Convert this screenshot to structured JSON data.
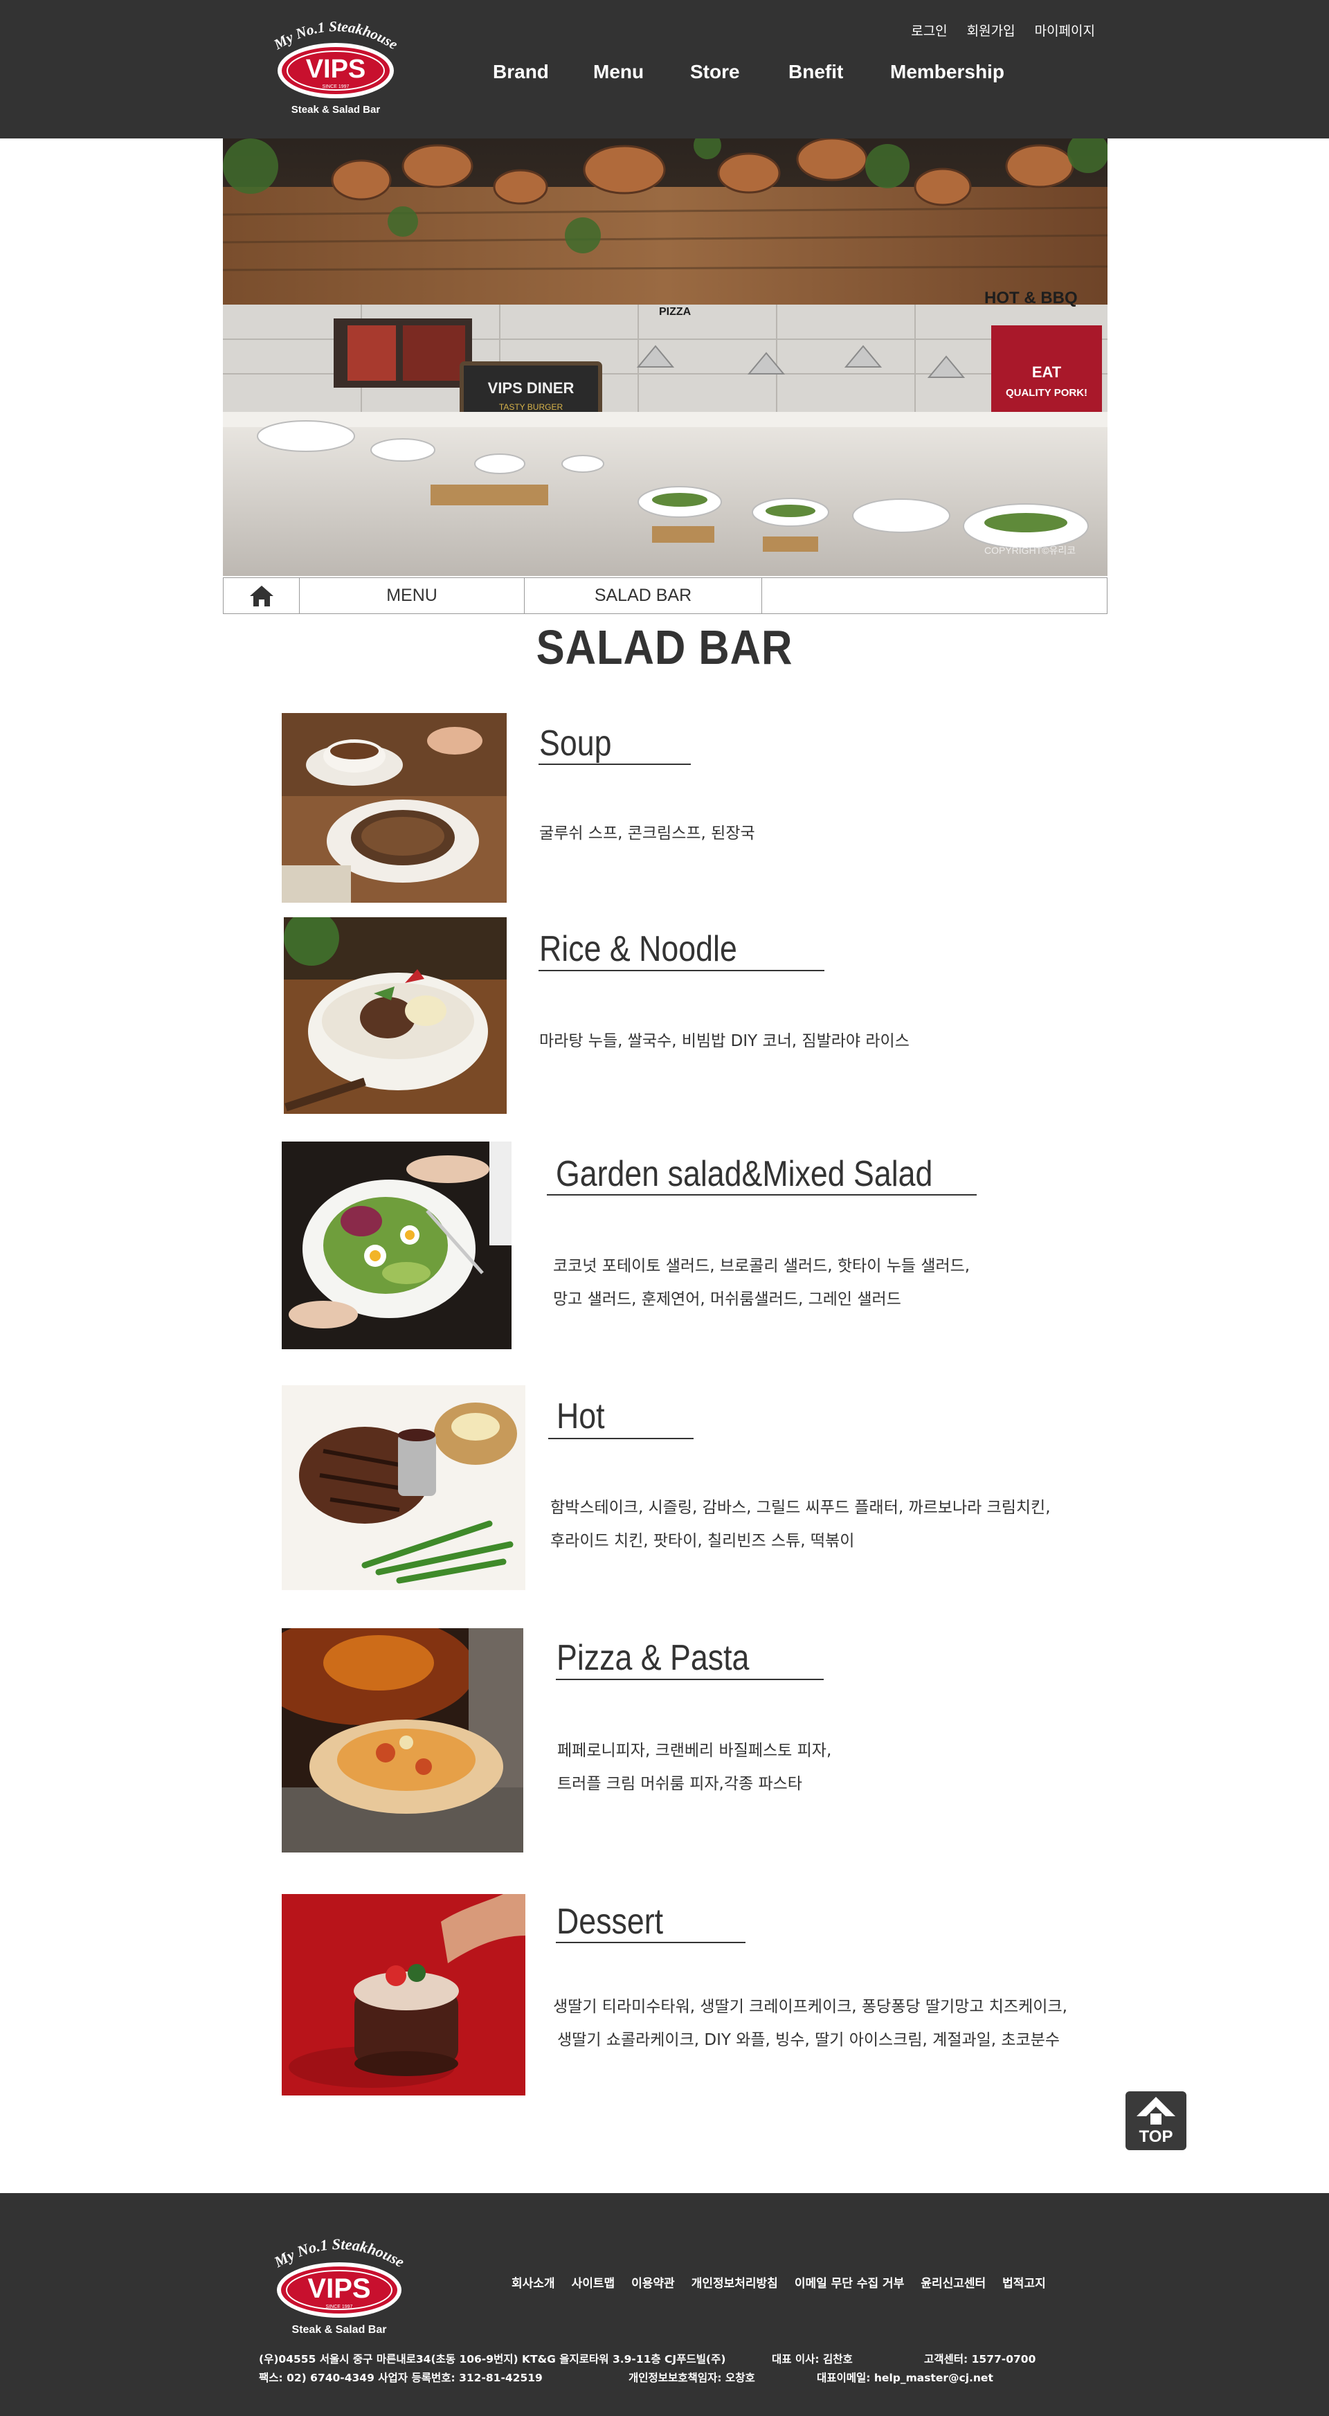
{
  "header": {
    "logo": {
      "tagline": "My No.1 Steakhouse",
      "brand": "VIPS",
      "since": "SINCE 1997",
      "subtitle": "Steak & Salad Bar"
    },
    "util_links": [
      "로그인",
      "회원가입",
      "마이페이지"
    ],
    "nav": [
      "Brand",
      "Menu",
      "Store",
      "Bnefit",
      "Membership"
    ]
  },
  "hero": {
    "signs": [
      "PIZZA",
      "HOT & BBQ",
      "VIPS DINER",
      "TASTY BURGER",
      "EAT",
      "QUALITY PORK!"
    ],
    "watermark": "COPYRIGHT©유리코"
  },
  "breadcrumb": {
    "home_icon": "home-icon",
    "items": [
      "MENU",
      "SALAD BAR"
    ]
  },
  "page_title": "SALAD BAR",
  "menu": [
    {
      "title": "Soup",
      "lines": [
        "굴루쉬 스프, 콘크림스프, 된장국"
      ]
    },
    {
      "title": "Rice & Noodle",
      "lines": [
        "마라탕 누들, 쌀국수, 비빔밥 DIY 코너, 짐발라야 라이스"
      ]
    },
    {
      "title": "Garden salad&Mixed Salad",
      "lines": [
        "코코넛 포테이토 샐러드, 브로콜리 샐러드, 핫타이 누들 샐러드,",
        "망고 샐러드, 훈제연어, 머쉬룸샐러드, 그레인 샐러드"
      ]
    },
    {
      "title": "Hot",
      "lines": [
        "함박스테이크, 시즐링, 감바스, 그릴드 씨푸드 플래터, 까르보나라 크림치킨,",
        "후라이드 치킨, 팟타이, 칠리빈즈 스튜, 떡볶이"
      ]
    },
    {
      "title": "Pizza & Pasta",
      "lines": [
        "페페로니피자, 크랜베리 바질페스토 피자,",
        "트러플 크림 머쉬룸 피자,각종 파스타"
      ]
    },
    {
      "title": "Dessert",
      "lines": [
        "생딸기 티라미수타워, 생딸기 크레이프케이크, 퐁당퐁당 딸기망고 치즈케이크,",
        "생딸기 쇼콜라케이크, DIY 와플, 빙수, 딸기 아이스크림, 계절과일, 초코분수"
      ]
    }
  ],
  "top_button": {
    "label": "TOP",
    "icon": "up-arrow-icon"
  },
  "footer": {
    "links": [
      "회사소개",
      "사이트맵",
      "이용약관",
      "개인정보처리방침",
      "이메일 무단 수집 거부",
      "윤리신고센터",
      "법적고지"
    ],
    "address": "(우)04555 서울시 중구 마른내로34(초동 106-9번지) KT&G 을지로타워 3.9-11층 CJ푸드빌(주)",
    "ceo": "대표 이사:  김찬호",
    "customer_center": "고객센터: 1577-0700",
    "fax_biz": "팩스: 02) 6740-4349 사업자 등록번호: 312-81-42519",
    "privacy_officer": "개인정보보호책임자: 오창호",
    "email": "대표이메일: help_master@cj.net"
  },
  "colors": {
    "header_bg": "#333333",
    "footer_bg": "#333333",
    "logo_red": "#c8102e",
    "text": "#333333"
  }
}
